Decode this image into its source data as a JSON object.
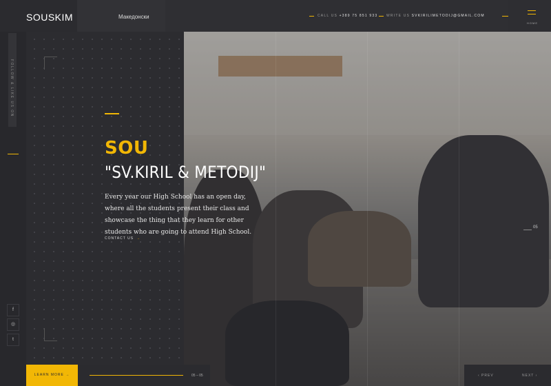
{
  "header": {
    "logo": "SOUSKIM",
    "language": "Македонски",
    "call_label": "CALL US",
    "call_value": "+389 75 851 933",
    "write_label": "WRITE US",
    "write_value": "SVKIRILIMETODIJ@GMAIL.COM",
    "menu_label": "HOME"
  },
  "sidebar": {
    "vertical_text": "FOLLOW & LIKE US ON",
    "social": [
      {
        "icon": "facebook-icon",
        "glyph": "f"
      },
      {
        "icon": "instagram-icon",
        "glyph": "◎"
      },
      {
        "icon": "twitter-icon",
        "glyph": "t"
      }
    ]
  },
  "hero": {
    "title_line1": "SOU",
    "title_line2": "\"SV.KIRIL & METODIJ\"",
    "description": "Every year our High School has an open day, where all the students present their class and showcase the thing that they learn for other students who are going to attend High School.",
    "contact_link": "CONTACT US",
    "contact_arrow": "→",
    "slide_number": "05"
  },
  "footer": {
    "learn_more": "LEARN MORE  →",
    "progress_label": "05 – 05",
    "progress_fraction": 1.0,
    "prev_label": "‹  PREV",
    "next_label": "NEXT  ›"
  },
  "colors": {
    "accent": "#f2b705",
    "background": "#2a2a2e"
  }
}
